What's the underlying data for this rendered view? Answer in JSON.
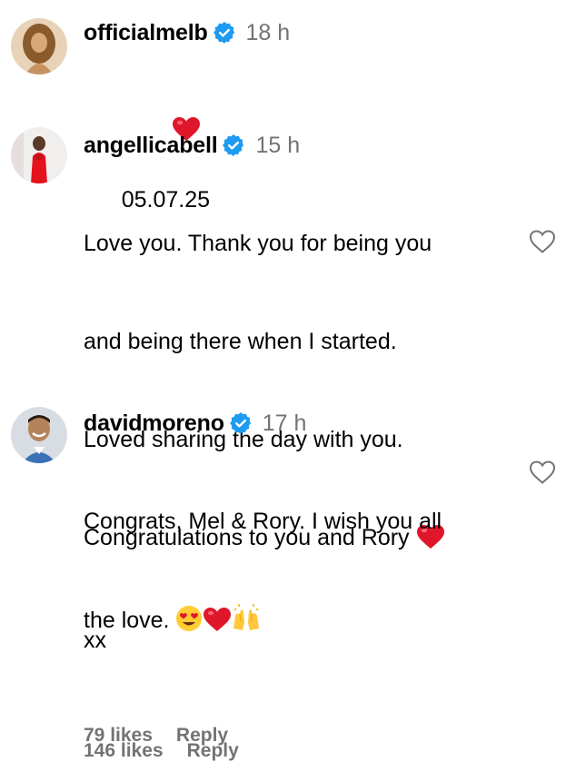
{
  "comments": [
    {
      "username": "officialmelb",
      "time": "18 h",
      "text_after_emoji": "05.07.25",
      "emoji_prefix": "red-heart"
    },
    {
      "username": "angellicabell",
      "time": "15 h",
      "lines": [
        "Love you. Thank you for being you",
        "and being there when I started.",
        "Loved sharing the day with you.",
        "Congratulations to you and Rory",
        "xx"
      ],
      "inline_emoji": "red-heart",
      "likes": "146 likes",
      "reply": "Reply"
    },
    {
      "username": "davidmoreno",
      "time": "17 h",
      "lines": [
        "Congrats, Mel & Rory. I wish you all",
        "the love."
      ],
      "trailing_emoji": [
        "heart-eyes-face",
        "red-heart",
        "raising-hands"
      ],
      "likes": "79 likes",
      "reply": "Reply"
    }
  ],
  "colors": {
    "verified": "#1d9bf0",
    "secondary_text": "#737373",
    "heart": "#e0162b"
  }
}
